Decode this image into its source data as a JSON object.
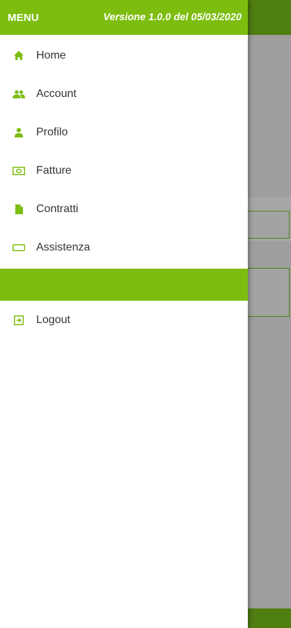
{
  "header": {
    "menu_label": "MENU",
    "version": "Versione 1.0.0 del 05/03/2020"
  },
  "menu": [
    {
      "label": "Home",
      "icon": "home-icon"
    },
    {
      "label": "Account",
      "icon": "people-icon"
    },
    {
      "label": "Profilo",
      "icon": "person-icon"
    },
    {
      "label": "Fatture",
      "icon": "invoice-icon"
    },
    {
      "label": "Contratti",
      "icon": "document-icon"
    },
    {
      "label": "Assistenza",
      "icon": "support-icon"
    }
  ],
  "logout": {
    "label": "Logout",
    "icon": "logout-icon"
  },
  "colors": {
    "accent": "#7cbd0f",
    "dark_accent": "#4f7e11",
    "scrim": "#9e9e9e"
  }
}
